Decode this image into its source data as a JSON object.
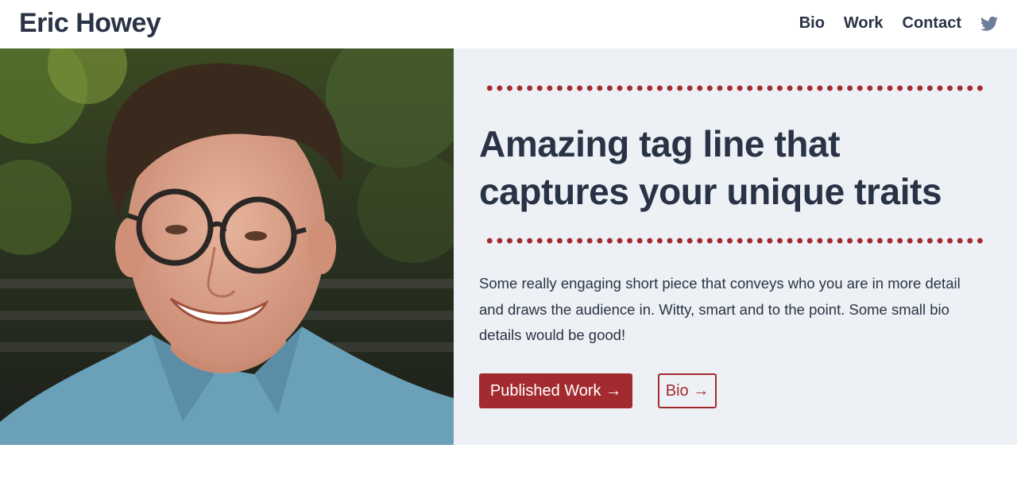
{
  "header": {
    "site_title": "Eric Howey",
    "nav": [
      "Bio",
      "Work",
      "Contact"
    ],
    "social_icon": "twitter-icon"
  },
  "hero": {
    "tagline_line1": "Amazing tag line that",
    "tagline_line2": "captures your unique traits",
    "blurb": "Some really engaging short piece that conveys who you are in more detail and draws the audience in. Witty, smart and to the point. Some small bio details would be good!",
    "primary_button": "Published Work →",
    "secondary_button": "Bio →"
  },
  "colors": {
    "accent": "#a32b2f",
    "text": "#2a3346",
    "hero_background": "#edf1f5"
  }
}
